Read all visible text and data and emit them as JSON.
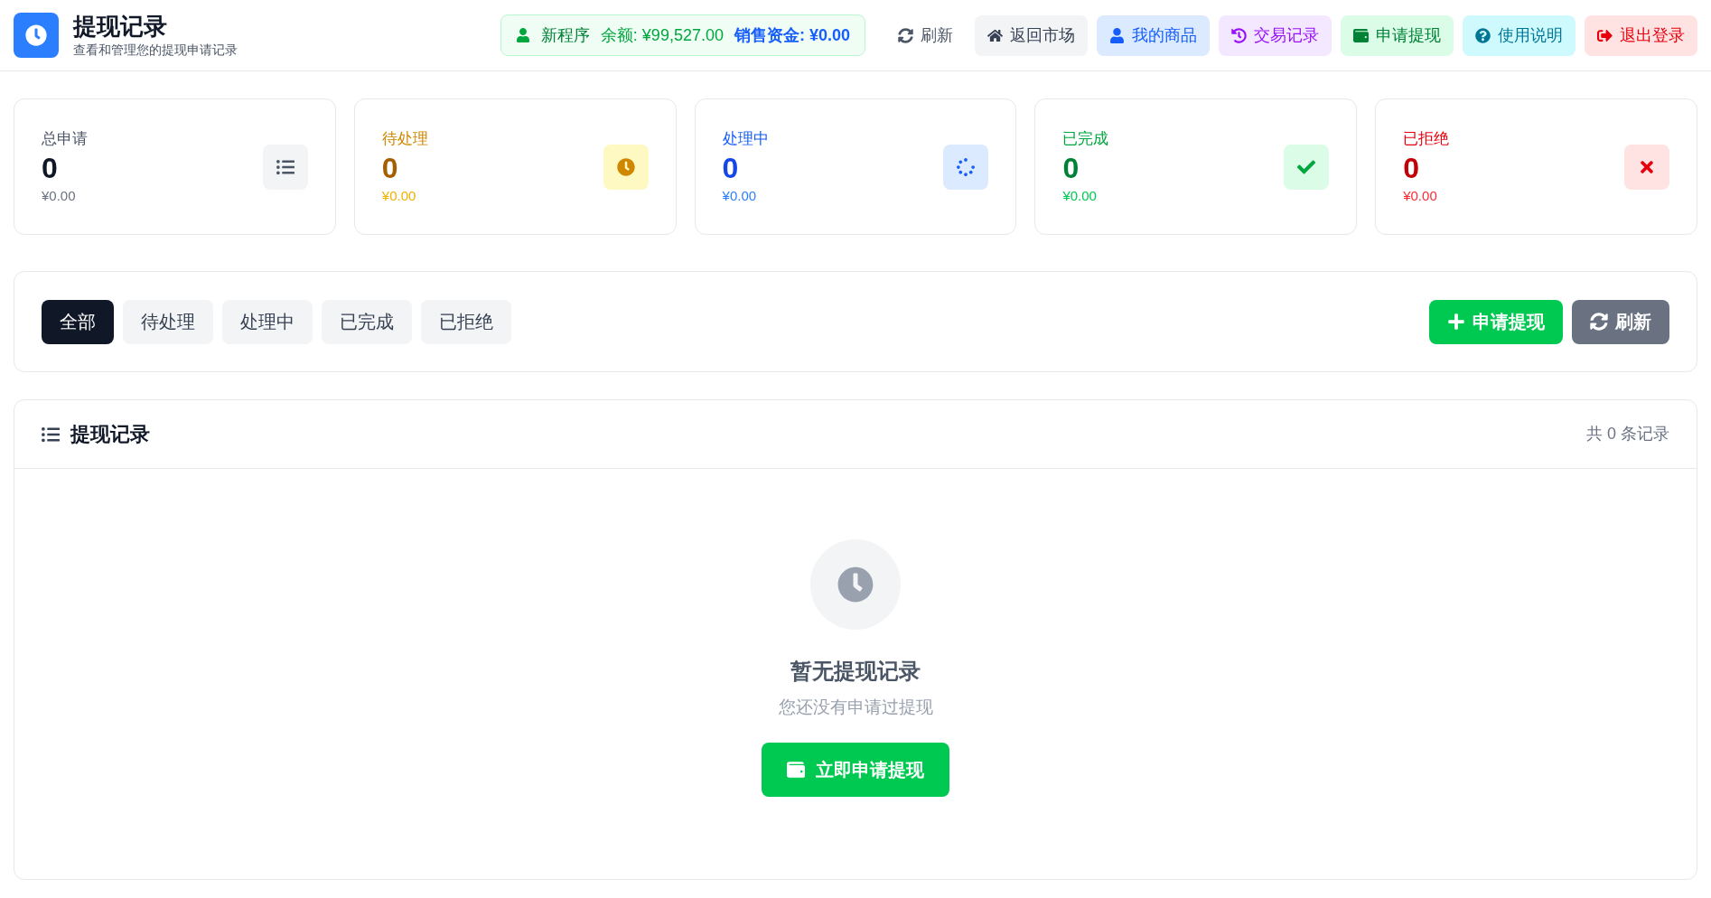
{
  "header": {
    "title": "提现记录",
    "subtitle": "查看和管理您的提现申请记录",
    "account": {
      "name": "新程序",
      "balance": "余额: ¥99,527.00",
      "sales": "销售资金: ¥0.00"
    },
    "nav": [
      {
        "kind": "refresh",
        "label": "刷新"
      },
      {
        "kind": "market",
        "label": "返回市场"
      },
      {
        "kind": "products",
        "label": "我的商品"
      },
      {
        "kind": "history",
        "label": "交易记录"
      },
      {
        "kind": "withdraw",
        "label": "申请提现"
      },
      {
        "kind": "help",
        "label": "使用说明"
      },
      {
        "kind": "logout",
        "label": "退出登录"
      }
    ]
  },
  "stats": [
    {
      "kind": "total",
      "label": "总申请",
      "count": "0",
      "amount": "¥0.00"
    },
    {
      "kind": "pending",
      "label": "待处理",
      "count": "0",
      "amount": "¥0.00"
    },
    {
      "kind": "processing",
      "label": "处理中",
      "count": "0",
      "amount": "¥0.00"
    },
    {
      "kind": "done",
      "label": "已完成",
      "count": "0",
      "amount": "¥0.00"
    },
    {
      "kind": "rejected",
      "label": "已拒绝",
      "count": "0",
      "amount": "¥0.00"
    }
  ],
  "filters": [
    {
      "label": "全部",
      "selected": true
    },
    {
      "label": "待处理",
      "selected": false
    },
    {
      "label": "处理中",
      "selected": false
    },
    {
      "label": "已完成",
      "selected": false
    },
    {
      "label": "已拒绝",
      "selected": false
    }
  ],
  "actions": [
    {
      "kind": "apply",
      "label": "申请提现"
    },
    {
      "kind": "refresh",
      "label": "刷新"
    }
  ],
  "records": {
    "title": "提现记录",
    "count": "共 0 条记录",
    "empty": {
      "title": "暂无提现记录",
      "message": "您还没有申请过提现",
      "button": "立即申请提现"
    }
  }
}
